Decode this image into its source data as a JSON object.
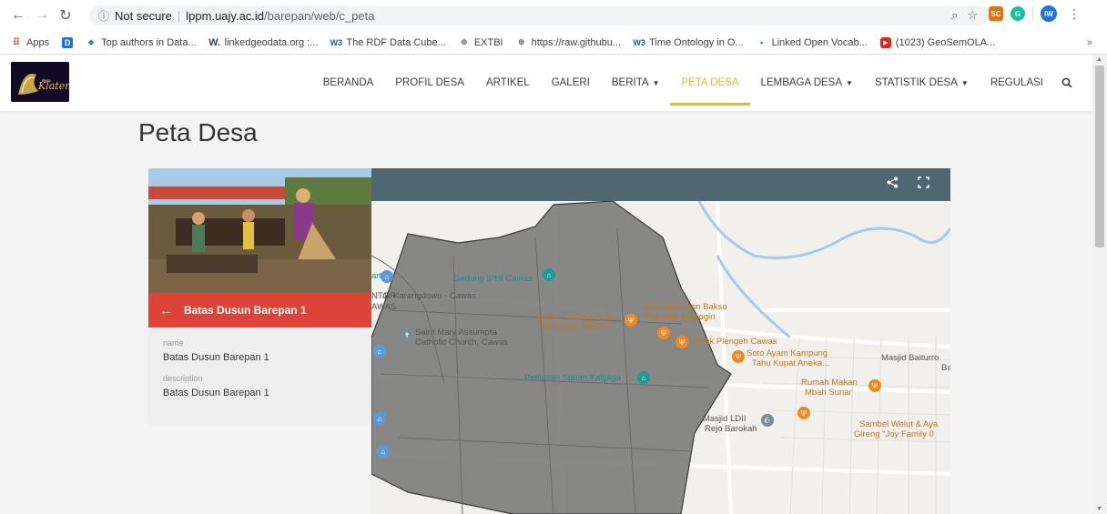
{
  "browser": {
    "security_label": "Not secure",
    "url_host": "lppm.uajy.ac.id",
    "url_path": "/barepan/web/c_peta",
    "ext_sc": "SC",
    "profile": "IW",
    "overflow": "»"
  },
  "bookmarks": [
    {
      "label": "Apps",
      "icon": "apps-grid-icon"
    },
    {
      "label": "",
      "icon": "bookmark-blue-icon"
    },
    {
      "label": "Top authors in Data...",
      "icon": "droplet-icon"
    },
    {
      "label": "linkedgeodata.org :...",
      "icon": "w-icon"
    },
    {
      "label": "The RDF Data Cube...",
      "icon": "w3-icon"
    },
    {
      "label": "EXTBI",
      "icon": "globe-icon"
    },
    {
      "label": "https://raw.githubu...",
      "icon": "globe-icon"
    },
    {
      "label": "Time Ontology in O...",
      "icon": "w3-icon"
    },
    {
      "label": "Linked Open Vocab...",
      "icon": "lov-icon"
    },
    {
      "label": "(1023) GeoSemOLA...",
      "icon": "youtube-icon"
    }
  ],
  "nav": {
    "items": [
      "BERANDA",
      "PROFIL DESA",
      "ARTIKEL",
      "GALERI",
      "BERITA",
      "PETA DESA",
      "LEMBAGA DESA",
      "STATISTIK DESA",
      "REGULASI"
    ],
    "active": "PETA DESA"
  },
  "page": {
    "title": "Peta Desa"
  },
  "panel": {
    "heading": "Batas Dusun Barepan 1",
    "name_label": "name",
    "name_value": "Batas Dusun Barepan 1",
    "desc_label": "description",
    "desc_value": "Batas Dusun Barepan 1"
  },
  "map": {
    "pois": [
      {
        "text": "Gedung IPHI Cawas",
        "style": "teal"
      },
      {
        "text": "Jl. Karangdowo - Cawas",
        "style": "grey"
      },
      {
        "text": "NTOR",
        "style": "grey"
      },
      {
        "text": "AWAS",
        "style": "grey"
      },
      {
        "text": "art",
        "style": "teal"
      },
      {
        "text": "Saint Mary Assumpta",
        "style": "grey"
      },
      {
        "text": "Catholic Church, Cawas",
        "style": "grey"
      },
      {
        "text": "Bubur Kacang Ijo &",
        "style": "orange"
      },
      {
        "text": "Es Doger \"RAGIL\"",
        "style": "orange"
      },
      {
        "text": "Mie Ayam Dan Bakso",
        "style": "orange"
      },
      {
        "text": "Pak Sigit Wonogiri",
        "style": "orange"
      },
      {
        "text": "Steak Plengeh Cawas",
        "style": "orange"
      },
      {
        "text": "Soto Ayam Kampung",
        "style": "orange"
      },
      {
        "text": "Tahu Kupat Aneka...",
        "style": "orange"
      },
      {
        "text": "Masjid Baiturro",
        "style": "grey"
      },
      {
        "text": "Ba",
        "style": "grey"
      },
      {
        "text": "Petilasan Sunan Kalijaga",
        "style": "teal"
      },
      {
        "text": "Rumah Makan",
        "style": "orange"
      },
      {
        "text": "Mbah Sunar",
        "style": "orange"
      },
      {
        "text": "Masjid LDII",
        "style": "grey"
      },
      {
        "text": "Rejo Barokah",
        "style": "grey"
      },
      {
        "text": "Sambel Welut & Aya",
        "style": "orange"
      },
      {
        "text": "Gireng \"Joy Family 0",
        "style": "orange"
      }
    ]
  }
}
